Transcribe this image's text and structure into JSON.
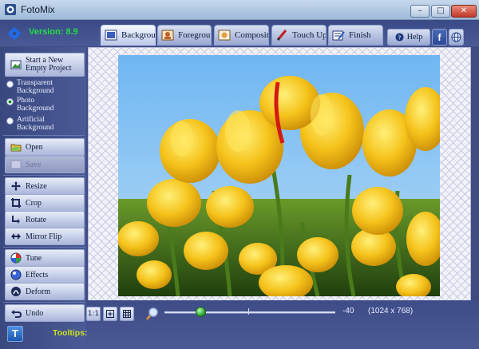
{
  "window": {
    "title": "FotoMix",
    "minimize": "–",
    "maximize": "□",
    "close": "✕"
  },
  "toolbar": {
    "version": "Version: 8.9",
    "tabs": [
      {
        "label": "Background",
        "icon": "background-icon",
        "active": true
      },
      {
        "label": "Foreground",
        "icon": "foreground-icon",
        "active": false
      },
      {
        "label": "Composition",
        "icon": "composition-icon",
        "active": false
      },
      {
        "label": "Touch Up",
        "icon": "touch-up-icon",
        "active": false
      },
      {
        "label": "Finish",
        "icon": "finish-icon",
        "active": false
      }
    ],
    "help_label": "Help",
    "facebook": "f",
    "web": "globe-icon"
  },
  "sidebar": {
    "new_project": "Start a New Empty Project",
    "background_options": [
      {
        "label": "Transparent Background",
        "selected": false
      },
      {
        "label": "Photo Background",
        "selected": true
      },
      {
        "label": "Artificial Background",
        "selected": false
      }
    ],
    "open": "Open",
    "save": "Save",
    "resize": "Resize",
    "crop": "Crop",
    "rotate": "Rotate",
    "mirror_flip": "Mirror Flip",
    "tune": "Tune",
    "effects": "Effects",
    "deform": "Deform",
    "undo": "Undo"
  },
  "bottom": {
    "fit_label": "1:1",
    "zoom_value": "-40",
    "zoom_slider_level": 0.21,
    "image_dimensions": "(1024 x 768)",
    "tooltips_label": "Tooltips:",
    "tooltips_button": "T"
  },
  "colors": {
    "accent": "#3e4c82",
    "version_text": "#22dd44",
    "tooltips_text": "#c8e020"
  }
}
